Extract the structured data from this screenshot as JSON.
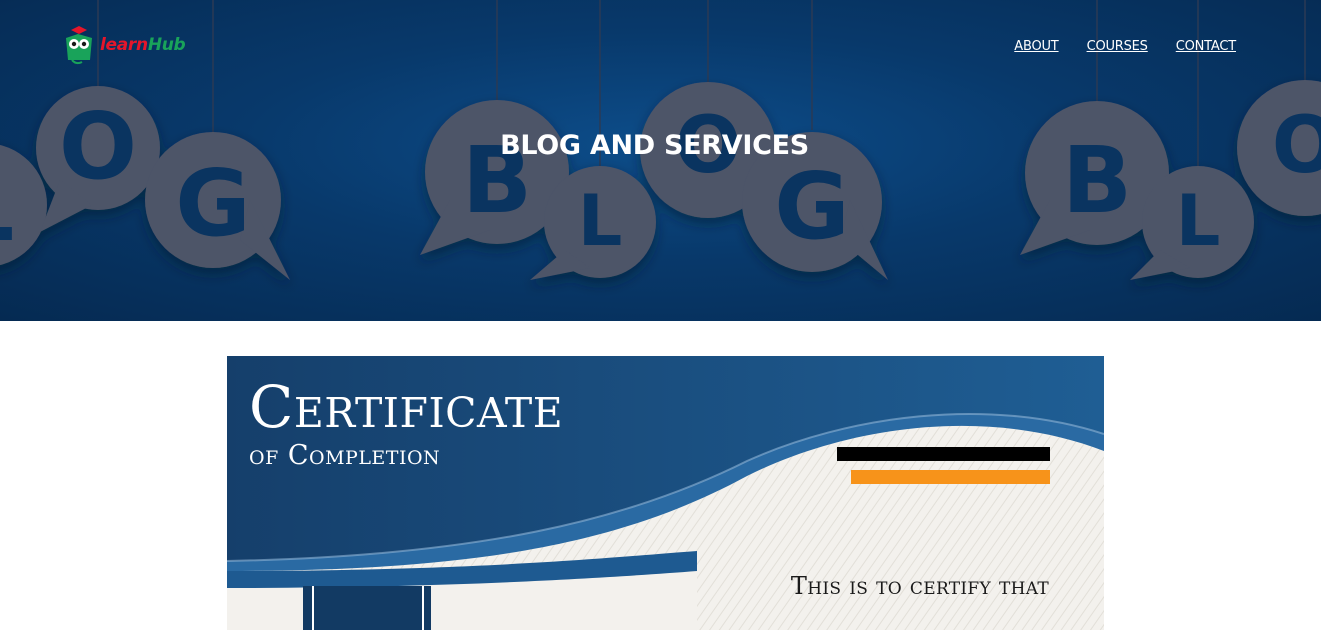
{
  "brand": {
    "name_part1": "learn",
    "name_part2": "Hub"
  },
  "nav": {
    "items": [
      "ABOUT",
      "COURSES",
      "CONTACT"
    ]
  },
  "hero": {
    "title": "BLOG AND SERVICES",
    "bubble_letters": [
      "B",
      "L",
      "O",
      "G"
    ]
  },
  "certificate": {
    "title": "Certificate",
    "subtitle": "of Completion",
    "certify_text": "This is to certify that"
  },
  "colors": {
    "hero_bg": "#08396b",
    "bubble": "#4d5468",
    "cert_blue": "#1c4f80",
    "cert_orange": "#f7931a",
    "logo_green": "#19a35a",
    "logo_red": "#e4162b"
  }
}
